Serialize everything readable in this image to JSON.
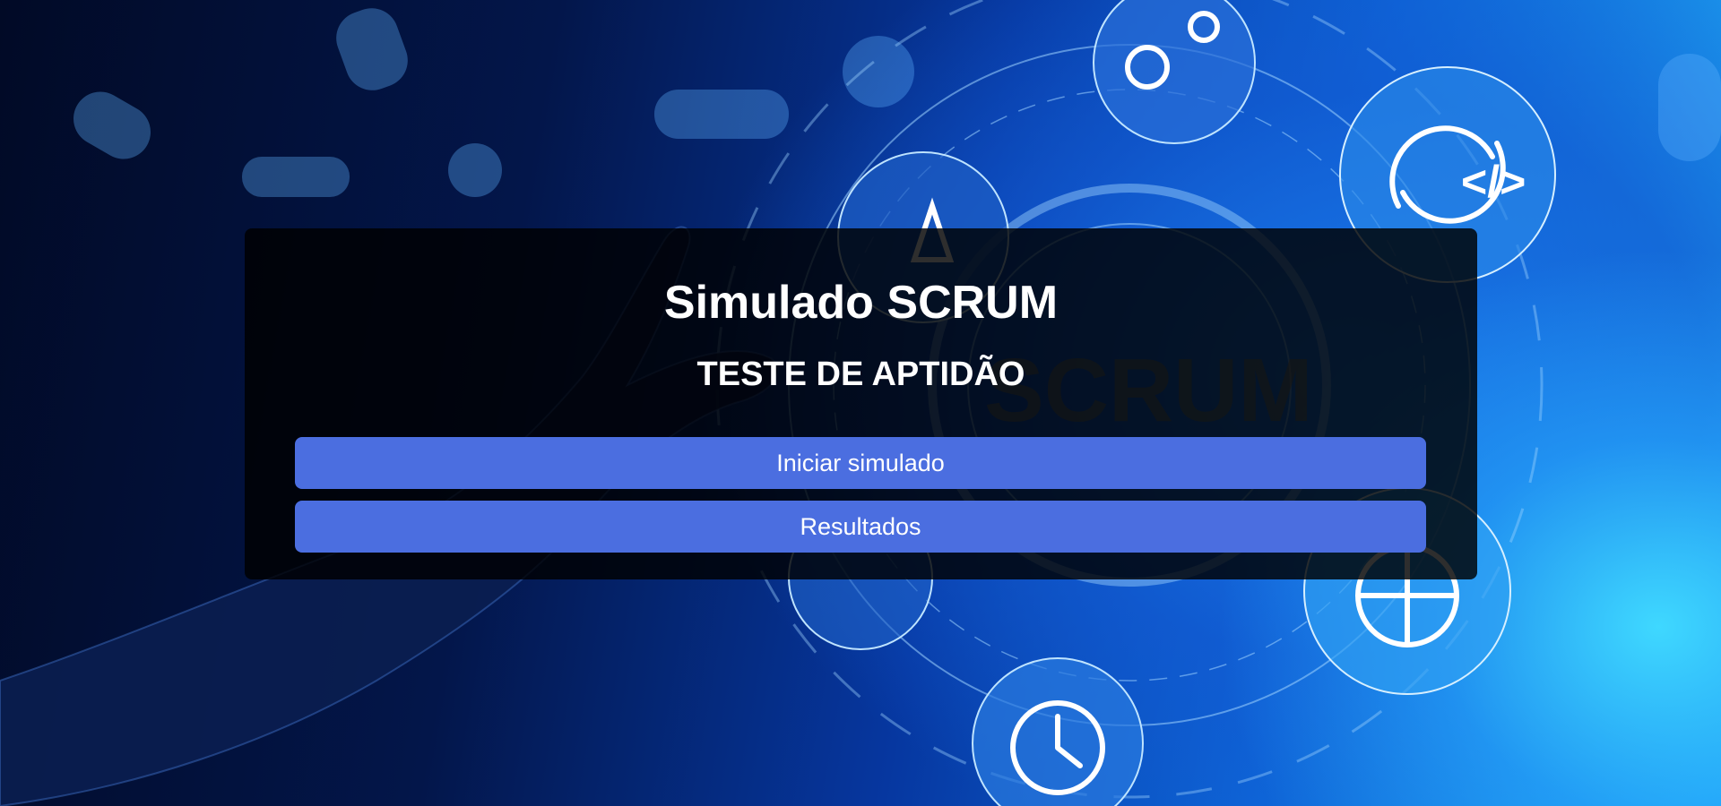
{
  "page": {
    "title": "Simulado SCRUM",
    "subtitle": "TESTE DE APTIDÃO"
  },
  "buttons": {
    "start_label": "Iniciar simulado",
    "results_label": "Resultados"
  },
  "background": {
    "image_subject": "SCRUM",
    "icons": [
      "gears-icon",
      "rocket-icon",
      "code-cycle-icon",
      "globe-icon",
      "clock-icon",
      "cloud-icon"
    ]
  },
  "colors": {
    "button_bg": "#4b6ee0",
    "card_bg": "rgba(0,0,0,0.82)",
    "text": "#ffffff",
    "bg_dark": "#010a26",
    "bg_light": "#3fd8ff"
  }
}
